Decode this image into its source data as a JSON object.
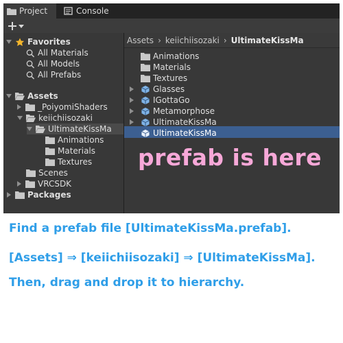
{
  "tabs": [
    {
      "label": "Project",
      "icon": "folder-icon"
    },
    {
      "label": "Console",
      "icon": "console-icon"
    }
  ],
  "toolbar": {
    "add_icon": "plus-icon",
    "dropdown_icon": "caret-down-icon"
  },
  "left_tree": {
    "favorites": {
      "label": "Favorites",
      "items": [
        "All Materials",
        "All Models",
        "All Prefabs"
      ]
    },
    "assets": {
      "label": "Assets",
      "poiyomi": "_PoiyomiShaders",
      "keiichi": "keiichiisozaki",
      "ultimate": "UltimateKissMa",
      "ultimate_children": [
        "Animations",
        "Materials",
        "Textures"
      ],
      "scenes": "Scenes",
      "vrcsdk": "VRCSDK"
    },
    "packages": "Packages"
  },
  "breadcrumb": [
    "Assets",
    "keiichiisozaki",
    "UltimateKissMa"
  ],
  "right_items": [
    {
      "label": "Animations",
      "type": "folder"
    },
    {
      "label": "Materials",
      "type": "folder"
    },
    {
      "label": "Textures",
      "type": "folder"
    },
    {
      "label": "Glasses",
      "type": "prefab"
    },
    {
      "label": "IGottaGo",
      "type": "prefab"
    },
    {
      "label": "Metamorphose",
      "type": "prefab"
    },
    {
      "label": "UltimateKissMa",
      "type": "prefab"
    },
    {
      "label": "UltimateKissMa",
      "type": "prefab-selected"
    }
  ],
  "annotation": "prefab is here",
  "instructions": [
    "Find a prefab file [UltimateKissMa.prefab].",
    "[Assets] ⇒ [keiichiisozaki] ⇒ [UltimateKissMa].",
    "Then, drag and drop it to hierarchy."
  ],
  "colors": {
    "annotation": "#f7a8d8",
    "instructions": "#2f9ee8",
    "selection": "#3c5f91",
    "favorites_star": "#f3b52c"
  }
}
